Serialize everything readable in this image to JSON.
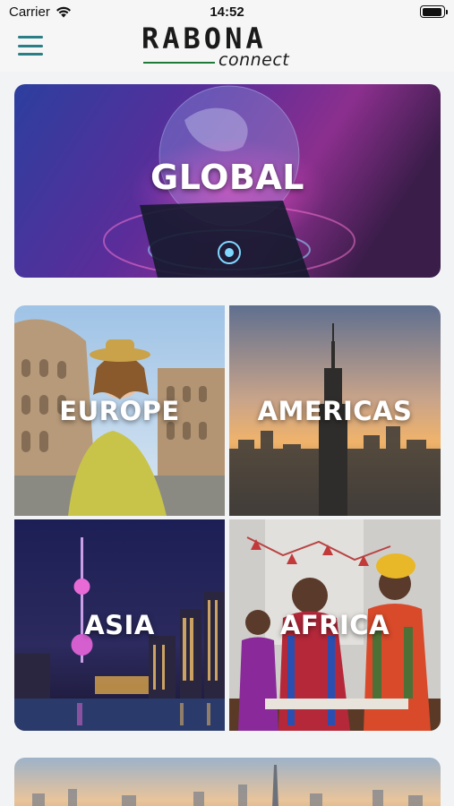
{
  "status_bar": {
    "carrier": "Carrier",
    "time": "14:52",
    "battery_level": 0.95
  },
  "header": {
    "menu_icon": "hamburger-icon",
    "logo_main": "RABONA",
    "logo_sub": "connect",
    "accent_color": "#2a7e86",
    "logo_line_color": "#1f7a3a"
  },
  "regions": {
    "global": "GLOBAL",
    "europe": "EUROPE",
    "americas": "AMERICAS",
    "asia": "ASIA",
    "africa": "AFRICA"
  }
}
